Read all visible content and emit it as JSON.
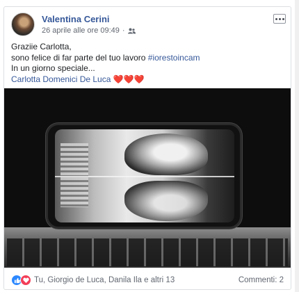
{
  "post": {
    "author": "Valentina Cerini",
    "timestamp": "26 aprile alle ore 09:49",
    "separator": "·",
    "audience_icon": "friends-icon",
    "text_lines": [
      "Graziie Carlotta,",
      "sono felice di far parte del tuo lavoro ",
      "In un giorno speciale..."
    ],
    "hashtag": "#iorestoincam",
    "mention": "Carlotta Domenici De Luca",
    "hearts": "❤️❤️❤️"
  },
  "footer": {
    "reaction_icons": [
      "like-icon",
      "love-icon"
    ],
    "reaction_names": "Tu, Giorgio de Luca, Danila Ila e altri 13",
    "comments": "Commenti: 2"
  }
}
